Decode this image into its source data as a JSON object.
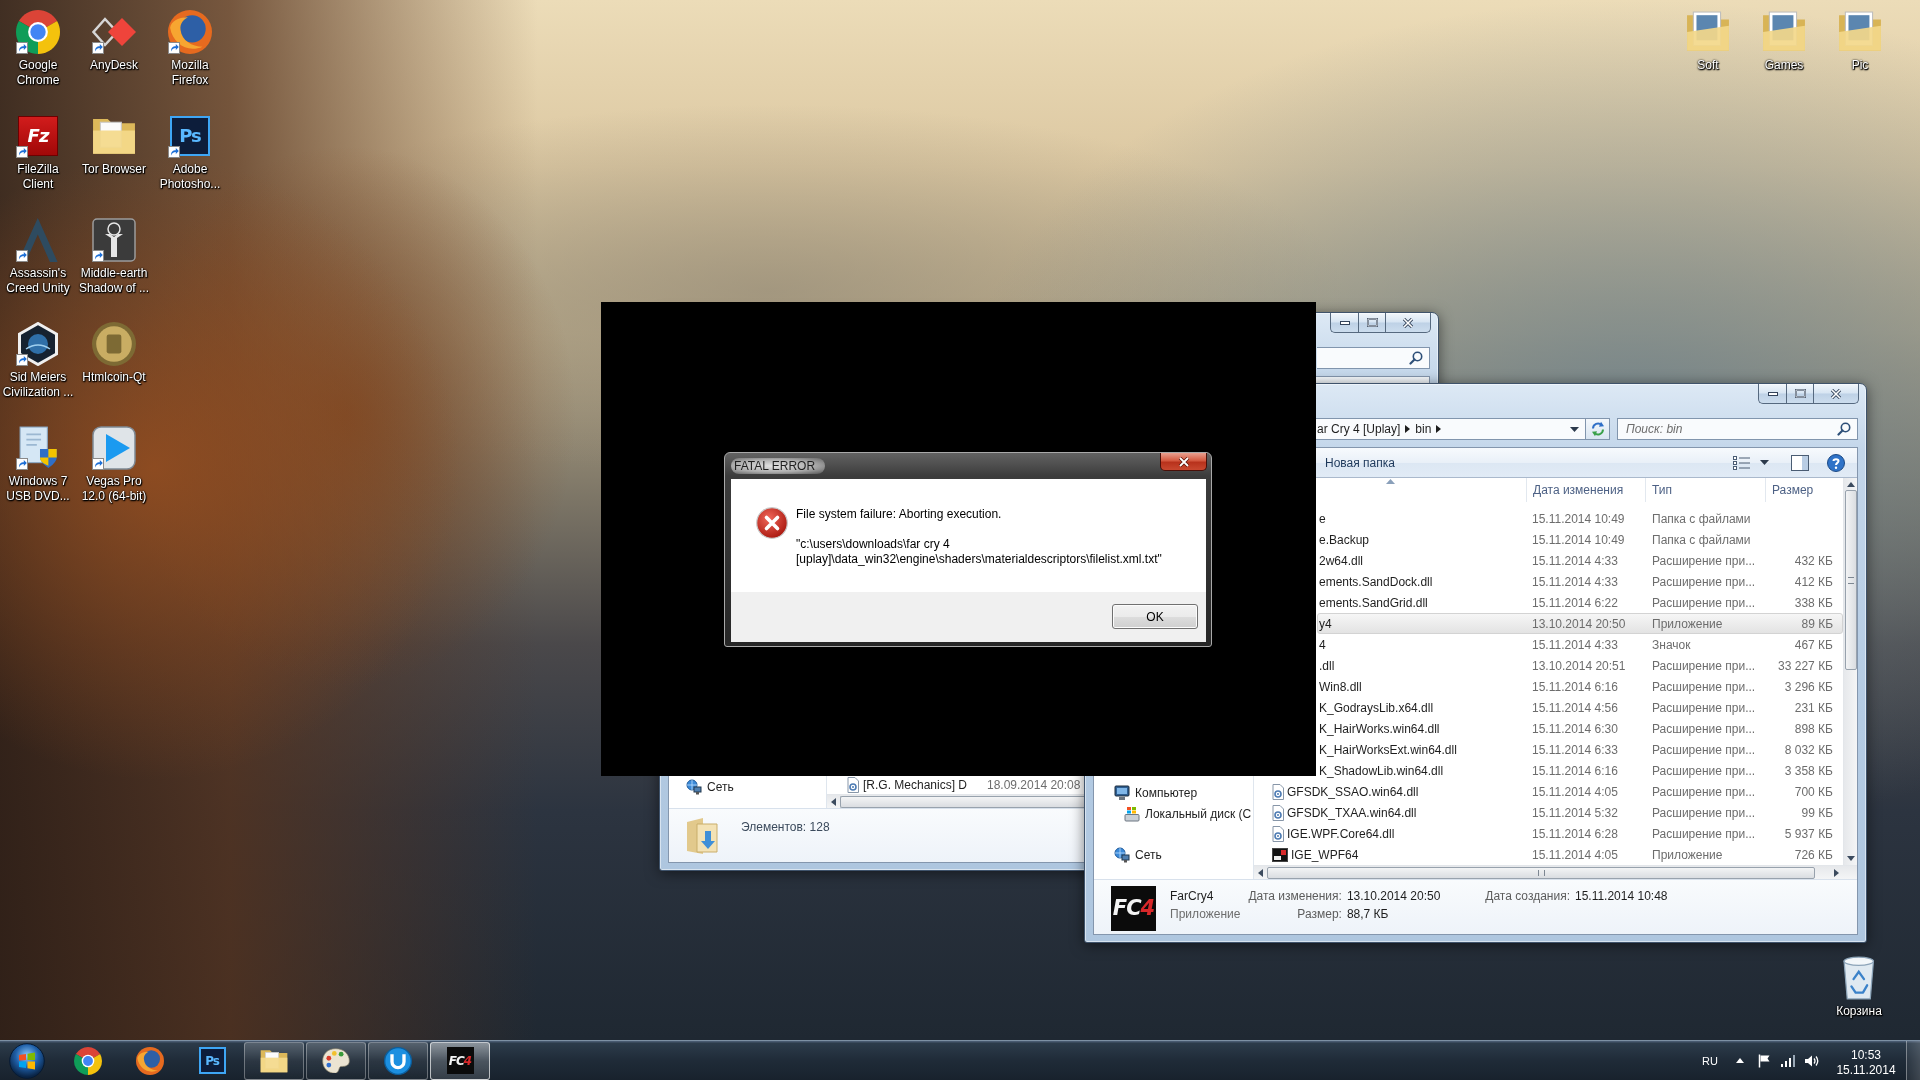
{
  "desktop": {
    "icons": [
      {
        "label": "Google Chrome",
        "kind": "chrome",
        "shortcut": true
      },
      {
        "label": "FileZilla Client",
        "kind": "filezilla",
        "glyph": "Fz",
        "shortcut": true
      },
      {
        "label": "Assassin's Creed Unity",
        "kind": "arch",
        "shortcut": true
      },
      {
        "label": "Sid Meiers Civilization ...",
        "kind": "hexagon",
        "shortcut": true
      },
      {
        "label": "Windows 7 USB DVD...",
        "kind": "installer",
        "shortcut": true
      },
      {
        "label": "AnyDesk",
        "kind": "diamond",
        "shortcut": true
      },
      {
        "label": "Tor Browser",
        "kind": "folder",
        "shortcut": false
      },
      {
        "label": "Middle-earth Shadow of ...",
        "kind": "emblem",
        "shortcut": true
      },
      {
        "label": "Htmlcoin-Qt",
        "kind": "coin",
        "shortcut": false
      },
      {
        "label": "Vegas Pro 12.0 (64-bit)",
        "kind": "play",
        "shortcut": true
      },
      {
        "label": "Mozilla Firefox",
        "kind": "firefox",
        "shortcut": true
      },
      {
        "label": "Adobe Photosho...",
        "kind": "photoshop",
        "glyph": "Ps",
        "shortcut": true
      }
    ],
    "folders": [
      {
        "label": "Soft"
      },
      {
        "label": "Games"
      },
      {
        "label": "Pic"
      }
    ],
    "recycle_bin": {
      "label": "Корзина"
    }
  },
  "explorer_back": {
    "nav": [
      {
        "label": "Сеть",
        "kind": "network"
      }
    ],
    "rows": [
      {
        "name": "[R.G. Mechanics] D",
        "date": "18.09.2014 20:08"
      }
    ],
    "status": "Элементов: 128"
  },
  "explorer_front": {
    "address": [
      "ar Cry 4 [Uplay]",
      "bin"
    ],
    "search": {
      "placeholder": "Поиск: bin"
    },
    "toolbar": [
      "Новая папка"
    ],
    "columns": [
      {
        "sorted": true
      },
      {
        "label": "Дата изменения",
        "sorted": false
      },
      {
        "label": "Тип",
        "sorted": false
      },
      {
        "label": "Размер",
        "sorted": false
      }
    ],
    "nav": [
      {
        "label": "Компьютер",
        "kind": "computer",
        "children": [
          {
            "label": "Локальный диск (C",
            "kind": "drive"
          }
        ]
      },
      {
        "label": "Сеть",
        "kind": "network"
      }
    ],
    "rows": [
      {
        "name": "e",
        "date": "15.11.2014 10:49",
        "type": "Папка с файлами",
        "selected": false
      },
      {
        "name": "e.Backup",
        "date": "15.11.2014 10:49",
        "type": "Папка с файлами",
        "selected": false
      },
      {
        "name": "2w64.dll",
        "date": "15.11.2014 4:33",
        "type": "Расширение при...",
        "size": "432 КБ",
        "selected": false
      },
      {
        "name": "ements.SandDock.dll",
        "date": "15.11.2014 4:33",
        "type": "Расширение при...",
        "size": "412 КБ",
        "selected": false
      },
      {
        "name": "ements.SandGrid.dll",
        "date": "15.11.2014 6:22",
        "type": "Расширение при...",
        "size": "338 КБ",
        "selected": false
      },
      {
        "name": "y4",
        "date": "13.10.2014 20:50",
        "type": "Приложение",
        "size": "89 КБ",
        "selected": true
      },
      {
        "name": "4",
        "date": "15.11.2014 4:33",
        "type": "Значок",
        "size": "467 КБ",
        "selected": false
      },
      {
        "name": ".dll",
        "date": "13.10.2014 20:51",
        "type": "Расширение при...",
        "size": "33 227 КБ",
        "selected": false
      },
      {
        "name": "Win8.dll",
        "date": "15.11.2014 6:16",
        "type": "Расширение при...",
        "size": "3 296 КБ",
        "selected": false
      },
      {
        "name": "K_GodraysLib.x64.dll",
        "date": "15.11.2014 4:56",
        "type": "Расширение при...",
        "size": "231 КБ",
        "selected": false
      },
      {
        "name": "K_HairWorks.win64.dll",
        "date": "15.11.2014 6:30",
        "type": "Расширение при...",
        "size": "898 КБ",
        "selected": false
      },
      {
        "name": "K_HairWorksExt.win64.dll",
        "date": "15.11.2014 6:33",
        "type": "Расширение при...",
        "size": "8 032 КБ",
        "selected": false
      },
      {
        "name": "K_ShadowLib.win64.dll",
        "date": "15.11.2014 6:16",
        "type": "Расширение при...",
        "size": "3 358 КБ",
        "selected": false
      },
      {
        "name": "GFSDK_SSAO.win64.dll",
        "kind": "dll",
        "date": "15.11.2014 4:05",
        "type": "Расширение при...",
        "size": "700 КБ",
        "selected": false
      },
      {
        "name": "GFSDK_TXAA.win64.dll",
        "kind": "dll",
        "date": "15.11.2014 5:32",
        "type": "Расширение при...",
        "size": "99 КБ",
        "selected": false
      },
      {
        "name": "IGE.WPF.Core64.dll",
        "kind": "dll",
        "date": "15.11.2014 6:28",
        "type": "Расширение при...",
        "size": "5 937 КБ",
        "selected": false
      },
      {
        "name": "IGE_WPF64",
        "kind": "app",
        "date": "15.11.2014 4:05",
        "type": "Приложение",
        "size": "726 КБ",
        "selected": false
      }
    ],
    "details": {
      "logo": {
        "text": "FC",
        "accent": "4"
      },
      "name": "FarCry4",
      "type": "Приложение",
      "fields": [
        {
          "label": "Дата изменения:",
          "value": "13.10.2014 20:50"
        },
        {
          "label": "Размер:",
          "value": "88,7 КБ"
        },
        {
          "label": "Дата создания:",
          "value": "15.11.2014 10:48"
        }
      ]
    }
  },
  "dialog": {
    "title": "FATAL ERROR",
    "message": "File system failure: Aborting execution.",
    "path": "\"c:\\users\\downloads\\far cry 4 [uplay]\\data_win32\\engine\\shaders\\materialdescriptors\\filelist.xml.txt\"",
    "buttons": [
      "OK"
    ]
  },
  "taskbar": {
    "apps": [
      {
        "kind": "chrome",
        "running": false,
        "active": false
      },
      {
        "kind": "firefox",
        "running": false,
        "active": false
      },
      {
        "kind": "photoshop",
        "glyph": "Ps",
        "running": false,
        "active": false
      },
      {
        "kind": "explorer",
        "running": true,
        "active": false
      },
      {
        "kind": "paint",
        "running": true,
        "active": false
      },
      {
        "kind": "uplay",
        "running": true,
        "active": false
      },
      {
        "kind": "fc4",
        "glyph": "FC",
        "accent": "4",
        "running": true,
        "active": true
      }
    ],
    "tray": {
      "language": "RU",
      "time": "10:53",
      "date": "15.11.2014"
    }
  }
}
